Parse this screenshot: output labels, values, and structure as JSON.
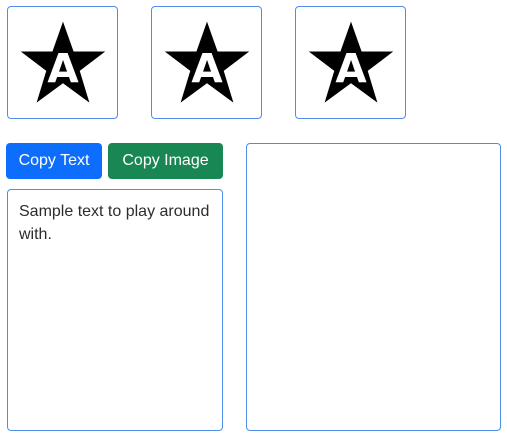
{
  "thumbnails": [
    {
      "icon": "star-letter-a-icon",
      "letter": "A"
    },
    {
      "icon": "star-letter-a-icon",
      "letter": "A"
    },
    {
      "icon": "star-letter-a-icon",
      "letter": "A"
    }
  ],
  "buttons": {
    "copy_text": "Copy Text",
    "copy_image": "Copy Image"
  },
  "text_area": {
    "value": "Sample text to play around with."
  },
  "paste_area": {
    "content": ""
  },
  "colors": {
    "primary": "#0d6efd",
    "success": "#198754",
    "border": "#4f8ee8",
    "icon_fill": "#000000",
    "icon_letter": "#ffffff"
  }
}
